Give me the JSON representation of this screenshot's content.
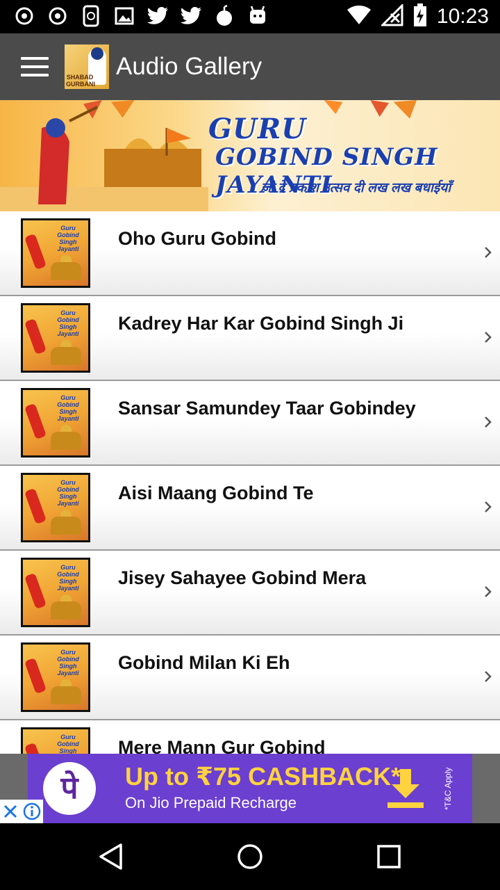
{
  "status_bar": {
    "time": "10:23",
    "left_icons": [
      "app-icon",
      "app-icon",
      "whatsapp-icon",
      "image-icon",
      "twitter-icon",
      "twitter-icon",
      "bomb-icon",
      "android-icon"
    ],
    "right_icons": [
      "wifi-icon",
      "no-signal-icon",
      "battery-charging-icon"
    ]
  },
  "app_bar": {
    "title": "Audio Gallery",
    "logo_text": "SHABAD GURBANI"
  },
  "banner": {
    "title_line1": "GURU",
    "title_line2": "GOBIND SINGH JAYANTI",
    "subtitle": "जी दे प्रकाश उत्सव दी लख लख बधाईयाँ"
  },
  "thumb_text": "Guru Gobind Singh Jayanti",
  "list": {
    "items": [
      {
        "title": "Oho Guru Gobind"
      },
      {
        "title": "Kadrey Har Kar Gobind Singh Ji"
      },
      {
        "title": "Sansar Samundey Taar Gobindey"
      },
      {
        "title": "Aisi Maang Gobind Te"
      },
      {
        "title": "Jisey Sahayee Gobind Mera"
      },
      {
        "title": "Gobind Milan Ki Eh"
      },
      {
        "title": "Mere Mann Gur Gobind"
      }
    ]
  },
  "ad": {
    "logo": "पे",
    "headline": "Up to ₹75 CASHBACK*",
    "sub": "On Jio Prepaid Recharge",
    "tc": "*T&C Apply",
    "colors": {
      "background": "#6b3fd0",
      "headline": "#ffd23f",
      "download": "#ffd23f"
    }
  },
  "colors": {
    "app_bar": "#4b4b4b",
    "status_bar": "#000000",
    "banner_title": "#1a3fb0"
  }
}
